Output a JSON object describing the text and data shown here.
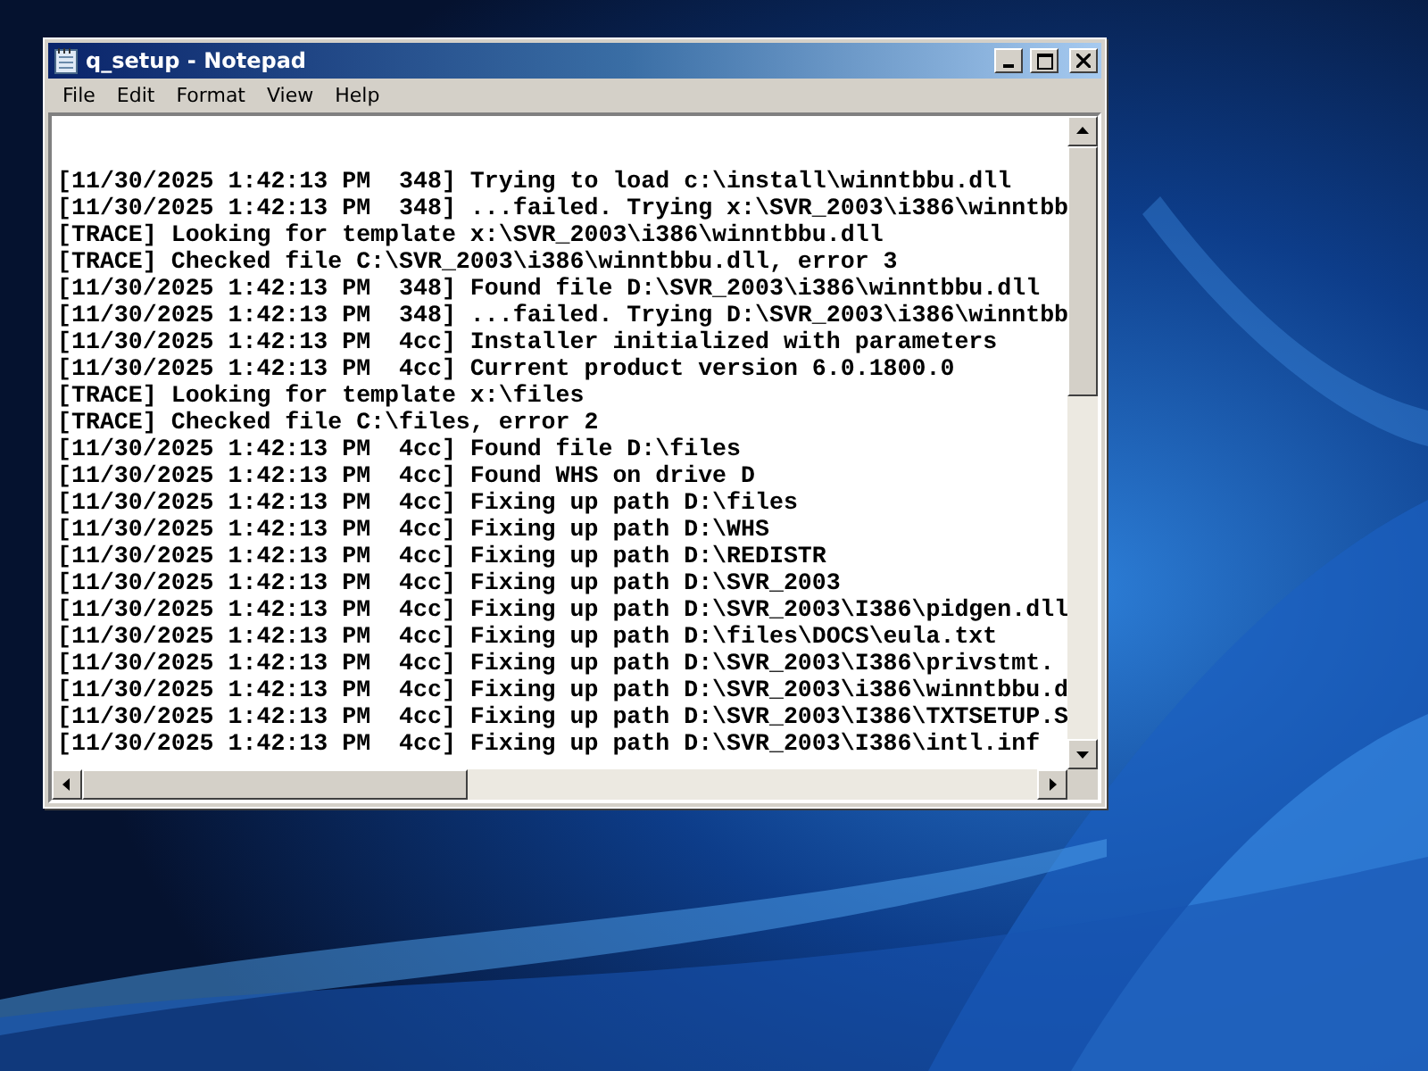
{
  "window": {
    "title": "q_setup - Notepad"
  },
  "menu": [
    {
      "label": "File"
    },
    {
      "label": "Edit"
    },
    {
      "label": "Format"
    },
    {
      "label": "View"
    },
    {
      "label": "Help"
    }
  ],
  "lines": [
    "[11/30/2025 1:42:13 PM  348] Trying to load c:\\install\\winntbbu.dll",
    "[11/30/2025 1:42:13 PM  348] ...failed. Trying x:\\SVR_2003\\i386\\winntbb",
    "[TRACE] Looking for template x:\\SVR_2003\\i386\\winntbbu.dll",
    "[TRACE] Checked file C:\\SVR_2003\\i386\\winntbbu.dll, error 3",
    "[11/30/2025 1:42:13 PM  348] Found file D:\\SVR_2003\\i386\\winntbbu.dll",
    "[11/30/2025 1:42:13 PM  348] ...failed. Trying D:\\SVR_2003\\i386\\winntbb",
    "[11/30/2025 1:42:13 PM  4cc] Installer initialized with parameters",
    "[11/30/2025 1:42:13 PM  4cc] Current product version 6.0.1800.0",
    "[TRACE] Looking for template x:\\files",
    "[TRACE] Checked file C:\\files, error 2",
    "[11/30/2025 1:42:13 PM  4cc] Found file D:\\files",
    "[11/30/2025 1:42:13 PM  4cc] Found WHS on drive D",
    "[11/30/2025 1:42:13 PM  4cc] Fixing up path D:\\files",
    "[11/30/2025 1:42:13 PM  4cc] Fixing up path D:\\WHS",
    "[11/30/2025 1:42:13 PM  4cc] Fixing up path D:\\REDISTR",
    "[11/30/2025 1:42:13 PM  4cc] Fixing up path D:\\SVR_2003",
    "[11/30/2025 1:42:13 PM  4cc] Fixing up path D:\\SVR_2003\\I386\\pidgen.dll",
    "[11/30/2025 1:42:13 PM  4cc] Fixing up path D:\\files\\DOCS\\eula.txt",
    "[11/30/2025 1:42:13 PM  4cc] Fixing up path D:\\SVR_2003\\I386\\privstmt.",
    "[11/30/2025 1:42:13 PM  4cc] Fixing up path D:\\SVR_2003\\i386\\winntbbu.d",
    "[11/30/2025 1:42:13 PM  4cc] Fixing up path D:\\SVR_2003\\I386\\TXTSETUP.S",
    "[11/30/2025 1:42:13 PM  4cc] Fixing up path D:\\SVR_2003\\I386\\intl.inf"
  ]
}
